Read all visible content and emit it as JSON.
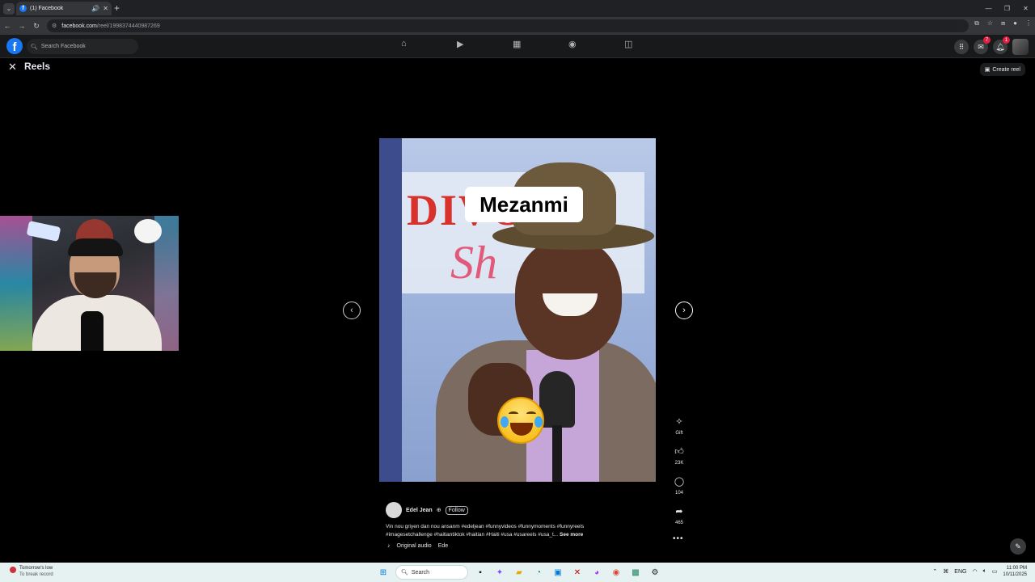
{
  "browser": {
    "tab_title": "(1) Facebook",
    "url_domain": "facebook.com",
    "url_path": "/reel/1998374440987269"
  },
  "facebook": {
    "search_placeholder": "Search Facebook",
    "messenger_badge": "7",
    "notifications_badge": "1"
  },
  "reels": {
    "title": "Reels",
    "create_reel_label": "Create reel"
  },
  "reel": {
    "caption_overlay": "Mezanmi",
    "author_name": "Edel Jean",
    "follow_label": "Follow",
    "description_line1": "Vin nou griyen dan nou ansanm #edeljean #funnyvideos #funnymoments #funnyreels",
    "description_line2": "#imagesetchallenge #haitiantiktok #haitian #Haiti #usa #usareels #usa_t...",
    "see_more_label": "See more",
    "audio_label": "Original audio",
    "audio_author": "Ede"
  },
  "actions": {
    "gift_label": "Gift",
    "likes_count": "23K",
    "comments_count": "104",
    "shares_count": "465"
  },
  "taskbar": {
    "weather_line1": "Tomorrow's low",
    "weather_line2": "To break record",
    "search_label": "Search",
    "language": "ENG",
    "time": "11:00 PM",
    "date": "10/11/2025"
  }
}
